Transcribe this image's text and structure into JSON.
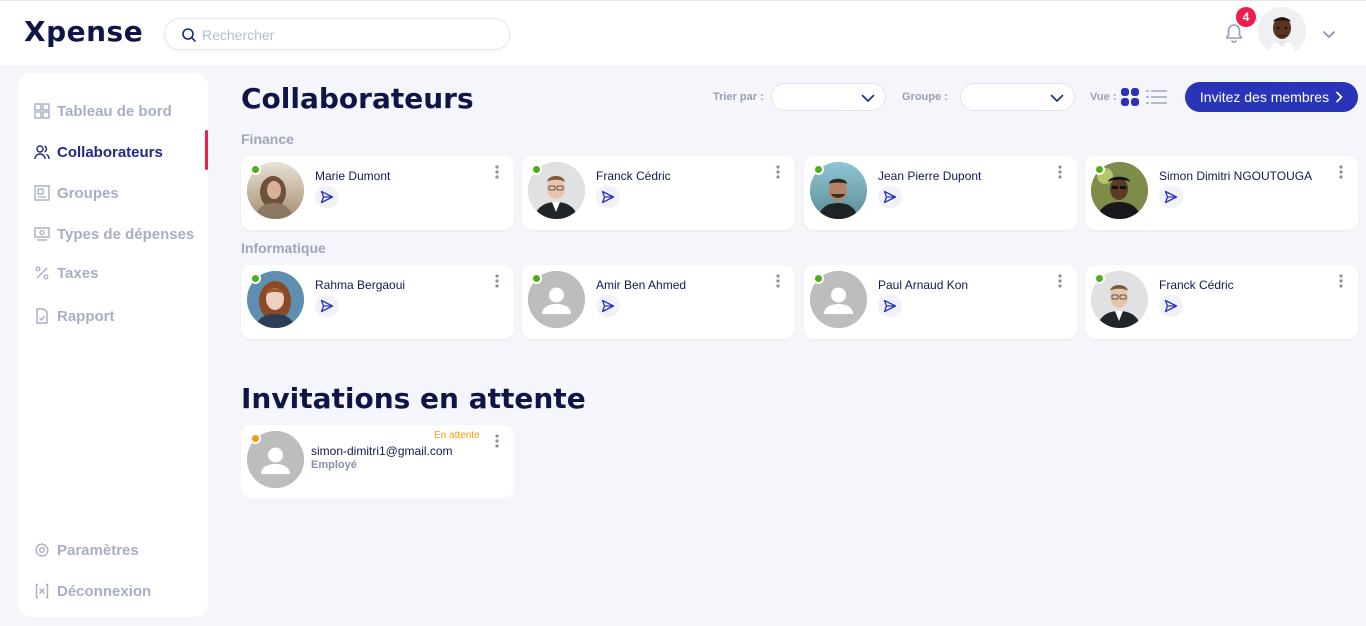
{
  "app": {
    "logo": "Xpense"
  },
  "search": {
    "placeholder": "Rechercher"
  },
  "notifications": {
    "count": "4"
  },
  "sidebar": {
    "items": [
      {
        "label": "Tableau de bord",
        "icon": "dashboard-icon"
      },
      {
        "label": "Collaborateurs",
        "icon": "users-icon",
        "active": true
      },
      {
        "label": "Groupes",
        "icon": "groups-icon"
      },
      {
        "label": "Types de dépenses",
        "icon": "expense-types-icon"
      },
      {
        "label": "Taxes",
        "icon": "percent-icon"
      },
      {
        "label": "Rapport",
        "icon": "report-icon"
      }
    ],
    "bottom": [
      {
        "label": "Paramètres",
        "icon": "gear-icon"
      },
      {
        "label": "Déconnexion",
        "icon": "logout-icon"
      }
    ]
  },
  "page": {
    "title": "Collaborateurs",
    "sort_label": "Trier par :",
    "group_label": "Groupe :",
    "view_label": "Vue :",
    "invite_label": "Invitez des membres"
  },
  "groups": [
    {
      "name": "Finance",
      "members": [
        {
          "name": "Marie Dumont",
          "photo": true
        },
        {
          "name": "Franck Cédric",
          "photo": true
        },
        {
          "name": "Jean Pierre Dupont",
          "photo": true
        },
        {
          "name": "Simon Dimitri NGOUTOUGA",
          "photo": true
        }
      ]
    },
    {
      "name": "Informatique",
      "members": [
        {
          "name": "Rahma Bergaoui",
          "photo": true
        },
        {
          "name": "Amir Ben Ahmed",
          "photo": false
        },
        {
          "name": "Paul Arnaud Kon",
          "photo": false
        },
        {
          "name": "Franck Cédric",
          "photo": true
        }
      ]
    }
  ],
  "invitations": {
    "title": "Invitations en attente",
    "items": [
      {
        "email": "simon-dimitri1@gmail.com",
        "role": "Employé",
        "status": "En attente"
      }
    ]
  },
  "colors": {
    "primary": "#2a34b8",
    "accent": "#ef1d4c",
    "online": "#4cae19",
    "pending": "#f39c12"
  }
}
